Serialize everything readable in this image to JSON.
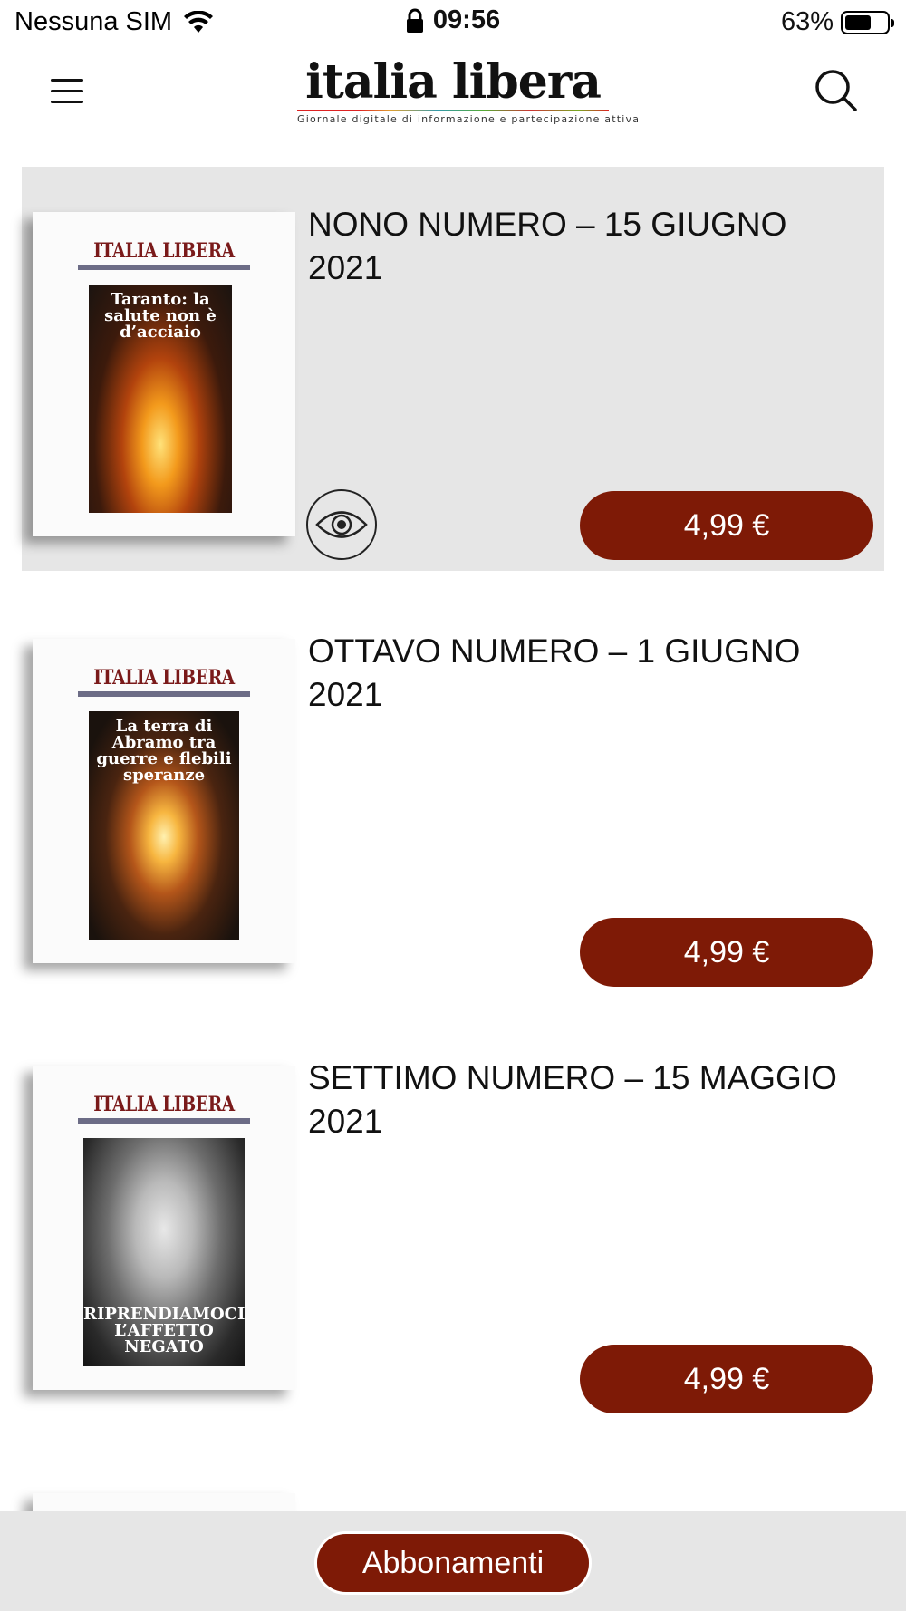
{
  "status_bar": {
    "carrier": "Nessuna SIM",
    "time": "09:56",
    "battery": "63%",
    "icons": [
      "wifi-icon",
      "lock-icon",
      "battery-icon"
    ]
  },
  "header": {
    "logo_title": "italia libera",
    "logo_subtitle": "Giornale digitale di informazione e partecipazione attiva",
    "icons": [
      "hamburger-menu-icon",
      "search-icon"
    ]
  },
  "cover_masthead": "ITALIA LIBERA",
  "issues": [
    {
      "title": "NONO NUMERO – 15 GIUGNO 2021",
      "price": "4,99 €",
      "cover_headline": "Taranto: la salute non è d’acciaio",
      "has_preview": true
    },
    {
      "title": "OTTAVO NUMERO – 1 GIUGNO 2021",
      "price": "4,99 €",
      "cover_headline": "La terra di Abramo tra guerre e flebili speranze",
      "has_preview": false
    },
    {
      "title": "SETTIMO NUMERO – 15 MAGGIO 2021",
      "price": "4,99 €",
      "cover_headline": "RIPRENDIAMOCI L’AFFETTO NEGATO",
      "has_preview": false
    }
  ],
  "bottom_bar": {
    "subscriptions_label": "Abbonamenti"
  },
  "colors": {
    "accent": "#7e1a06",
    "highlight_bg": "#e6e6e6",
    "cover_masthead": "#7a1a1a"
  }
}
